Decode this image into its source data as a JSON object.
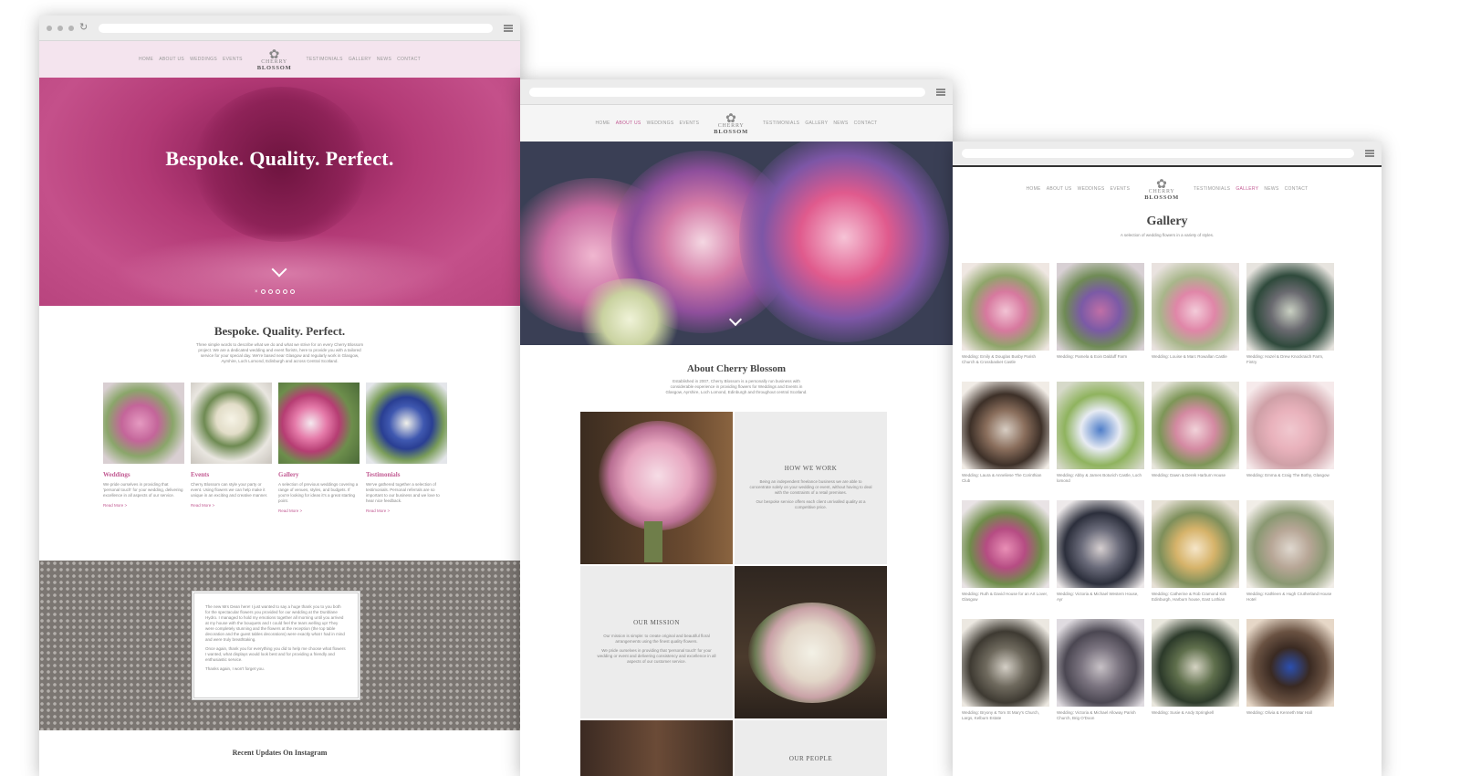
{
  "win1": {
    "nav": [
      "HOME",
      "ABOUT US",
      "WEDDINGS",
      "EVENTS",
      "TESTIMONIALS",
      "GALLERY",
      "NEWS",
      "CONTACT"
    ],
    "logo": {
      "line1": "CHERRY",
      "line2": "BLOSSOM"
    },
    "hero_title": "Bespoke. Quality. Perfect.",
    "intro_title": "Bespoke. Quality. Perfect.",
    "intro_text": "Three simple words to describe what we do and what we strive for on every Cherry Blossom project. We are a dedicated wedding and event florists, here to provide you with a tailored service for your special day. We're based near Glasgow and regularly work in Glasgow, Ayrshire, Loch Lomond, Edinburgh and across Central Scotland.",
    "cards": [
      {
        "title": "Weddings",
        "text": "We pride ourselves in providing that 'personal touch' for your wedding, delivering excellence in all aspects of our service.",
        "more": "Read More >"
      },
      {
        "title": "Events",
        "text": "Cherry Blossom can style your party or event. Using flowers we can help make it unique in an exciting and creative manner.",
        "more": "Read More >"
      },
      {
        "title": "Gallery",
        "text": "A selection of previous weddings covering a range of venues, styles, and budgets. If you're looking for ideas it's a great starting point.",
        "more": "Read More >"
      },
      {
        "title": "Testimonials",
        "text": "We've gathered together a selection of testimonials. Personal referrals are so important to our business and we love to hear nice feedback.",
        "more": "Read More >"
      }
    ],
    "testimonial": [
      "The new Mrs Dean here! I just wanted to say a huge thank you to you both for the spectacular flowers you provided for our wedding at the Dunblane Hydro. I managed to hold my emotions together all morning until you arrived at my house with the bouquets and I could feel the tears welling up! They were completely stunning and the flowers at the reception (the top table decoration and the guest tables decorations) were exactly what I had in mind and were truly breathtaking.",
      "Once again, thank you for everything you did to help me choose what flowers I wanted, what displays would look best and for providing a friendly and enthusiastic service.",
      "Thanks again, I won't forget you."
    ],
    "instagram": "Recent Updates On Instagram"
  },
  "win2": {
    "nav": [
      "HOME",
      "ABOUT US",
      "WEDDINGS",
      "EVENTS",
      "TESTIMONIALS",
      "GALLERY",
      "NEWS",
      "CONTACT"
    ],
    "about_title": "About Cherry Blossom",
    "about_text": "Established in 2007, Cherry Blossom is a personally run business with considerable experience in providing flowers for Weddings and Events in Glasgow, Ayrshire, Loch Lomond, Edinburgh and throughout central Scotland.",
    "how_title": "HOW WE WORK",
    "how_text": [
      "Being an independent freelance business we are able to concentrate solely on your wedding or event, without having to deal with the constraints of a retail premises.",
      "Our bespoke service offers each client unrivalled quality at a competitive price."
    ],
    "mission_title": "OUR MISSION",
    "mission_text": [
      "Our mission is simple: to create original and beautiful floral arrangements using the finest quality flowers.",
      "We pride ourselves in providing that 'personal touch' for your wedding or event and delivering consistency and excellence in all aspects of our customer service."
    ],
    "people_title": "OUR PEOPLE"
  },
  "win3": {
    "nav": [
      "HOME",
      "ABOUT US",
      "WEDDINGS",
      "EVENTS",
      "TESTIMONIALS",
      "GALLERY",
      "NEWS",
      "CONTACT"
    ],
    "title": "Gallery",
    "subtitle": "A selection of wedding flowers in a variety of styles.",
    "items": [
      "Wedding: Emily & Douglas Busby Parish Church & Crossbasket Castle",
      "Wedding: Pamela & Eoin Dalduff Farm",
      "Wedding: Louise & Marc Rowallan Castle",
      "Wedding: Hazel & Drew Knockraich Farm, Fintry",
      "Wedding: Laura & Anneliese The Corinthian Club",
      "Wedding: Abby & James Boturich Castle, Loch lomond",
      "Wedding: Dawn & Derek Harburn House",
      "Wedding: Emma & Craig The Bothy, Glasgow",
      "Wedding: Ruth & David House for an Art Lover, Glasgow",
      "Wedding: Victoria & Michael Western House, Ayr",
      "Wedding: Catherine & Rob Cramond Kirk Edinburgh, Harburn house, East Lothian",
      "Wedding: Kathleen & Hugh Crutherland House Hotel",
      "Wedding: Bryony & Tom St Mary's Church, Largs, Kelburn Estate",
      "Wedding: Victoria & Michael Alloway Parish Church, Brig O'Doon",
      "Wedding: Susie & Andy Springkell",
      "Wedding: Olivia & Kenneth Mar Hall"
    ]
  },
  "colors": {
    "accent": "#c25b93",
    "hero": "#b0346f",
    "pattern": "#7b7672"
  }
}
